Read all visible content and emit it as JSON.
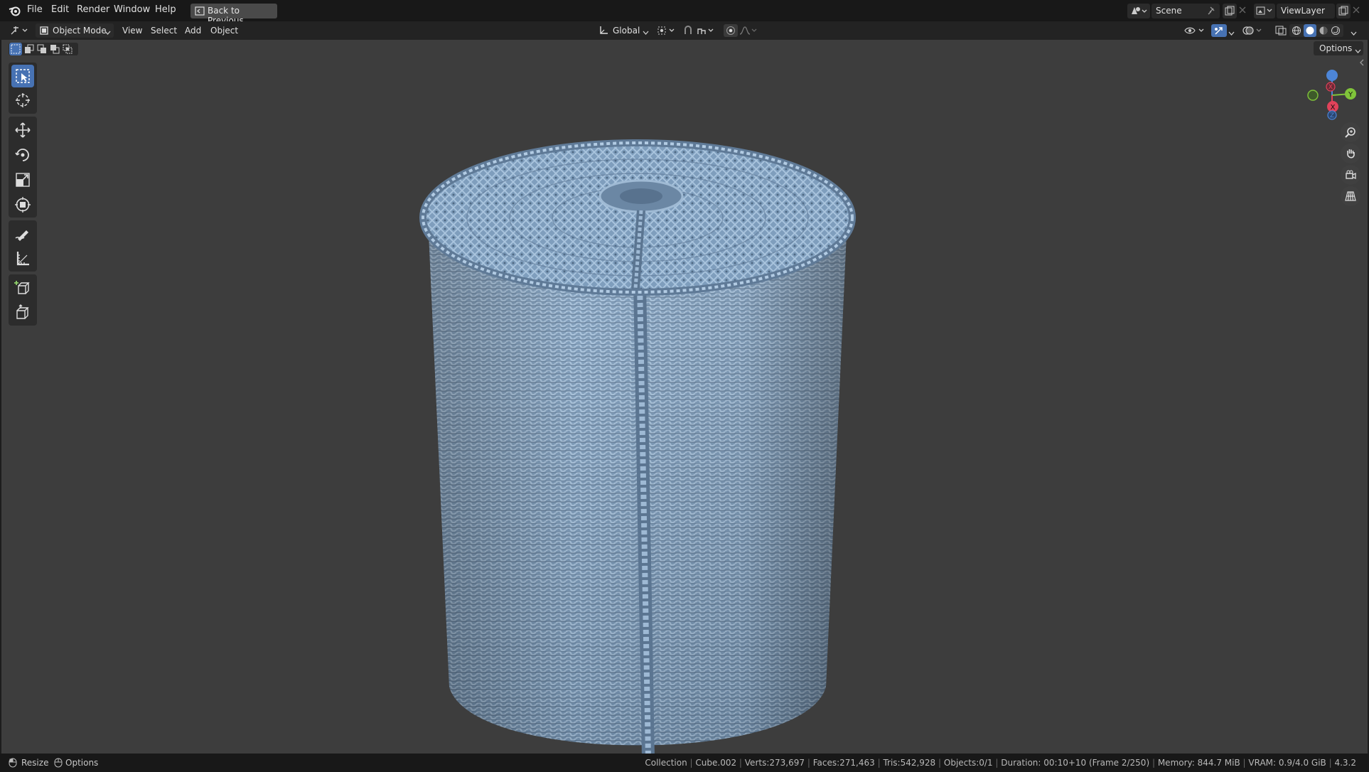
{
  "menubar": {
    "items": [
      "File",
      "Edit",
      "Render",
      "Window",
      "Help"
    ],
    "back_button": "Back to Previous",
    "scene_name": "Scene",
    "view_layer_name": "ViewLayer"
  },
  "viewport_header": {
    "mode": "Object Mode",
    "menus": [
      "View",
      "Select",
      "Add",
      "Object"
    ],
    "orientation": "Global",
    "options_label": "Options"
  },
  "toolbar": {
    "tools": [
      "select-box",
      "cursor",
      "move",
      "rotate",
      "scale",
      "transform",
      "annotate",
      "measure",
      "add-cube",
      "extrude"
    ],
    "active_tool": "select-box"
  },
  "gizmo": {
    "axes": [
      "X",
      "Y",
      "Z"
    ],
    "colors": {
      "x": "#e0425a",
      "y": "#80c43a",
      "z": "#4d86d8"
    }
  },
  "statusbar": {
    "left_items": [
      "Resize",
      "Options"
    ],
    "collection": "Collection",
    "object": "Cube.002",
    "verts": "Verts:273,697",
    "faces": "Faces:271,463",
    "tris": "Tris:542,928",
    "objects": "Objects:0/1",
    "duration": "Duration: 00:10+10 (Frame 2/250)",
    "memory": "Memory: 844.7 MiB",
    "vram": "VRAM: 0.9/4.0 GiB",
    "version": "4.3.2"
  },
  "colors": {
    "accent": "#4772b3",
    "viewport_bg": "#3d3d3d",
    "basket": "#8aa9c9"
  }
}
